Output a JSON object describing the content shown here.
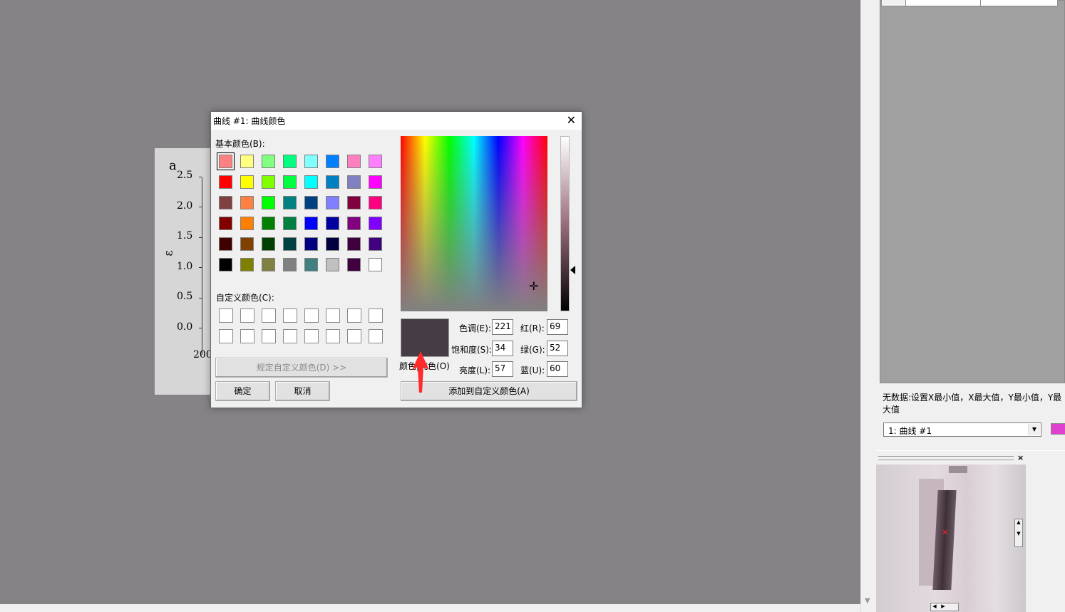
{
  "document": {
    "letter": "a",
    "ylabel": "ε",
    "ticks": [
      "2.5",
      "2.0",
      "1.5",
      "1.0",
      "0.5",
      "0.0"
    ],
    "x_tick": "200"
  },
  "right_panel": {
    "no_data_text": "无数据:设置X最小值，X最大值，Y最小值，Y最大值",
    "curve_select_value": "1: 曲线 #1",
    "curve_swatch_color": "#e040d0",
    "zoom_close": "×"
  },
  "dialog": {
    "title": "曲线 #1: 曲线颜色",
    "close": "✕",
    "basic_colors_label": "基本颜色(B):",
    "basic_colors": [
      [
        "#ff8080",
        "#ffff80",
        "#80ff80",
        "#00ff80",
        "#80ffff",
        "#0080ff",
        "#ff80c0",
        "#ff80ff"
      ],
      [
        "#ff0000",
        "#ffff00",
        "#80ff00",
        "#00ff40",
        "#00ffff",
        "#0080c0",
        "#8080c0",
        "#ff00ff"
      ],
      [
        "#804040",
        "#ff8040",
        "#00ff00",
        "#008080",
        "#004080",
        "#8080ff",
        "#800040",
        "#ff0080"
      ],
      [
        "#800000",
        "#ff8000",
        "#008000",
        "#008040",
        "#0000ff",
        "#0000a0",
        "#800080",
        "#8000ff"
      ],
      [
        "#400000",
        "#804000",
        "#004000",
        "#004040",
        "#000080",
        "#000040",
        "#400040",
        "#400080"
      ],
      [
        "#000000",
        "#808000",
        "#808040",
        "#808080",
        "#408080",
        "#c0c0c0",
        "#400040",
        "#ffffff"
      ]
    ],
    "custom_colors_label": "自定义颜色(C):",
    "define_custom_button": "规定自定义颜色(D) >>",
    "ok_button": "确定",
    "cancel_button": "取消",
    "color_solid_label": "颜色|纯色(O)",
    "hue_label": "色调(E):",
    "hue": "221",
    "sat_label": "饱和度(S):",
    "sat": "34",
    "lum_label": "亮度(L):",
    "lum": "57",
    "red_label": "红(R):",
    "red": "69",
    "green_label": "绿(G):",
    "green": "52",
    "blue_label": "蓝(U):",
    "blue": "60",
    "add_custom_button": "添加到自定义颜色(A)",
    "preview_color": "#453c45"
  }
}
